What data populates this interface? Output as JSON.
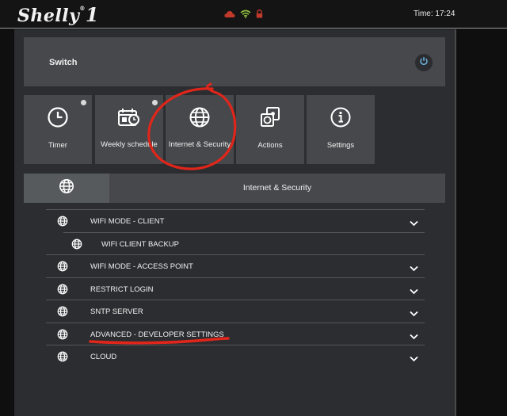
{
  "header": {
    "logo": "Shelly",
    "logo_mark": "®",
    "logo_number": "1",
    "time": "Time: 17:24",
    "icons": [
      "cloud-icon",
      "wifi-icon",
      "lock-icon"
    ],
    "colors": {
      "cloud": "#c0392b",
      "wifi": "#8fbf3f",
      "lock": "#c0392b"
    }
  },
  "device": {
    "name": "Switch",
    "power_icon": "power-icon"
  },
  "tiles": [
    {
      "label": "Timer",
      "icon": "clock-icon",
      "has_dot": true
    },
    {
      "label": "Weekly schedule",
      "icon": "schedule-icon",
      "has_dot": true
    },
    {
      "label": "Internet & Security",
      "icon": "globe-icon",
      "has_dot": false
    },
    {
      "label": "Actions",
      "icon": "actions-icon",
      "has_dot": false
    },
    {
      "label": "Settings",
      "icon": "info-icon",
      "has_dot": false
    }
  ],
  "section": {
    "title": "Internet & Security",
    "icon": "globe-icon"
  },
  "list": [
    {
      "label": "WIFI MODE - CLIENT",
      "sub": false,
      "expandable": true
    },
    {
      "label": "WIFI CLIENT BACKUP",
      "sub": true,
      "expandable": false
    },
    {
      "label": "WIFI MODE - ACCESS POINT",
      "sub": false,
      "expandable": true
    },
    {
      "label": "RESTRICT LOGIN",
      "sub": false,
      "expandable": true
    },
    {
      "label": "SNTP SERVER",
      "sub": false,
      "expandable": true
    },
    {
      "label": "ADVANCED - DEVELOPER SETTINGS",
      "sub": false,
      "expandable": true
    },
    {
      "label": "CLOUD",
      "sub": false,
      "expandable": true
    }
  ],
  "annotation_color": "#e0261b"
}
